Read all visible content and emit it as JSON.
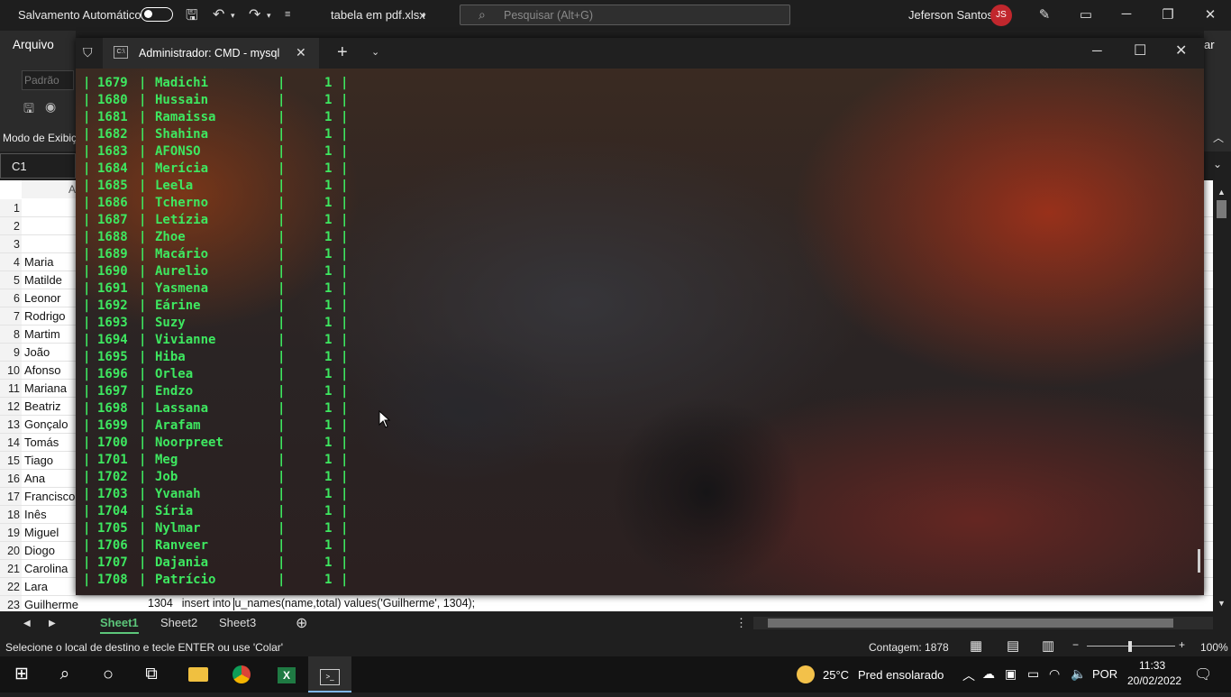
{
  "excel": {
    "autosave_label": "Salvamento Automático",
    "file_title": "tabela em pdf.xlsx",
    "search_placeholder": "Pesquisar (Alt+G)",
    "user_name": "Jeferson Santos",
    "user_initials": "JS",
    "ribbon_tab": "Arquivo",
    "style_field": "Padrão",
    "view_mode": "Modo de Exibiç",
    "ribbon_right_fragment": "ar",
    "name_box": "C1",
    "column_letter": "A",
    "rows": [
      {
        "num": "1",
        "a": ""
      },
      {
        "num": "2",
        "a": ""
      },
      {
        "num": "3",
        "a": ""
      },
      {
        "num": "4",
        "a": "Maria"
      },
      {
        "num": "5",
        "a": "Matilde"
      },
      {
        "num": "6",
        "a": "Leonor"
      },
      {
        "num": "7",
        "a": "Rodrigo"
      },
      {
        "num": "8",
        "a": "Martim"
      },
      {
        "num": "9",
        "a": "João"
      },
      {
        "num": "10",
        "a": "Afonso"
      },
      {
        "num": "11",
        "a": "Mariana"
      },
      {
        "num": "12",
        "a": "Beatriz"
      },
      {
        "num": "13",
        "a": "Gonçalo"
      },
      {
        "num": "14",
        "a": "Tomás"
      },
      {
        "num": "15",
        "a": "Tiago"
      },
      {
        "num": "16",
        "a": "Ana"
      },
      {
        "num": "17",
        "a": "Francisco"
      },
      {
        "num": "18",
        "a": "Inês"
      },
      {
        "num": "19",
        "a": "Miguel"
      },
      {
        "num": "20",
        "a": "Diogo"
      },
      {
        "num": "21",
        "a": "Carolina"
      },
      {
        "num": "22",
        "a": "Lara"
      },
      {
        "num": "23",
        "a": "Guilherme"
      }
    ],
    "row23_b": "1304",
    "row23_c_pre": "insert into ",
    "row23_c_post": "u_names(name,total) values('Guilherme', 1304);",
    "sheets": [
      "Sheet1",
      "Sheet2",
      "Sheet3"
    ],
    "active_sheet": "Sheet1",
    "status_message": "Selecione o local de destino e tecle ENTER ou use 'Colar'",
    "count_label": "Contagem: 1878",
    "zoom": "100%"
  },
  "cmd": {
    "tab_title": "Administrador: CMD - mysql",
    "rows": [
      {
        "id": "1679",
        "name": "Madichi",
        "total": "1"
      },
      {
        "id": "1680",
        "name": "Hussain",
        "total": "1"
      },
      {
        "id": "1681",
        "name": "Ramaissa",
        "total": "1"
      },
      {
        "id": "1682",
        "name": "Shahina",
        "total": "1"
      },
      {
        "id": "1683",
        "name": "AFONSO",
        "total": "1"
      },
      {
        "id": "1684",
        "name": "Merícia",
        "total": "1"
      },
      {
        "id": "1685",
        "name": "Leela",
        "total": "1"
      },
      {
        "id": "1686",
        "name": "Tcherno",
        "total": "1"
      },
      {
        "id": "1687",
        "name": "Letízia",
        "total": "1"
      },
      {
        "id": "1688",
        "name": "Zhoe",
        "total": "1"
      },
      {
        "id": "1689",
        "name": "Macário",
        "total": "1"
      },
      {
        "id": "1690",
        "name": "Aurelio",
        "total": "1"
      },
      {
        "id": "1691",
        "name": "Yasmena",
        "total": "1"
      },
      {
        "id": "1692",
        "name": "Eárine",
        "total": "1"
      },
      {
        "id": "1693",
        "name": "Suzy",
        "total": "1"
      },
      {
        "id": "1694",
        "name": "Vivianne",
        "total": "1"
      },
      {
        "id": "1695",
        "name": "Hiba",
        "total": "1"
      },
      {
        "id": "1696",
        "name": "Orlea",
        "total": "1"
      },
      {
        "id": "1697",
        "name": "Endzo",
        "total": "1"
      },
      {
        "id": "1698",
        "name": "Lassana",
        "total": "1"
      },
      {
        "id": "1699",
        "name": "Arafam",
        "total": "1"
      },
      {
        "id": "1700",
        "name": "Noorpreet",
        "total": "1"
      },
      {
        "id": "1701",
        "name": "Meg",
        "total": "1"
      },
      {
        "id": "1702",
        "name": "Job",
        "total": "1"
      },
      {
        "id": "1703",
        "name": "Yvanah",
        "total": "1"
      },
      {
        "id": "1704",
        "name": "Síria",
        "total": "1"
      },
      {
        "id": "1705",
        "name": "Nylmar",
        "total": "1"
      },
      {
        "id": "1706",
        "name": "Ranveer",
        "total": "1"
      },
      {
        "id": "1707",
        "name": "Dajania",
        "total": "1"
      },
      {
        "id": "1708",
        "name": "Patrício",
        "total": "1"
      }
    ]
  },
  "taskbar": {
    "temperature": "25°C",
    "weather": "Pred ensolarado",
    "language": "POR",
    "time": "11:33",
    "date": "20/02/2022"
  },
  "colors": {
    "terminal_text": "#3ee860",
    "excel_accent": "#5cc67a",
    "avatar": "#c1272d"
  }
}
